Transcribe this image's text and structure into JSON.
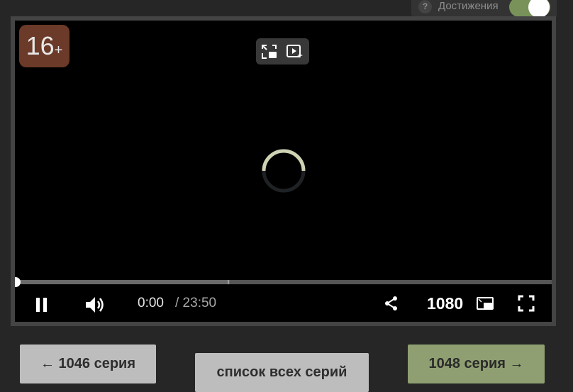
{
  "achievements": {
    "help": "?",
    "label": "Достижения",
    "enabled": true,
    "accent": "#78925a"
  },
  "player": {
    "age_rating": "16",
    "age_plus": "+",
    "state": "loading",
    "current_time": "0:00",
    "total_time": "/ 23:50",
    "quality": "1080",
    "progress": 0,
    "buffered": 0.4,
    "icons": [
      "pip-exit-icon",
      "autoplay-icon",
      "spinner-icon",
      "pause-icon",
      "volume-icon",
      "share-icon",
      "miniplayer-icon",
      "fullscreen-icon"
    ]
  },
  "nav": {
    "prev_label": "← 1046 серия",
    "list_label": "список всех серий",
    "next_label": "1048 серия →"
  }
}
